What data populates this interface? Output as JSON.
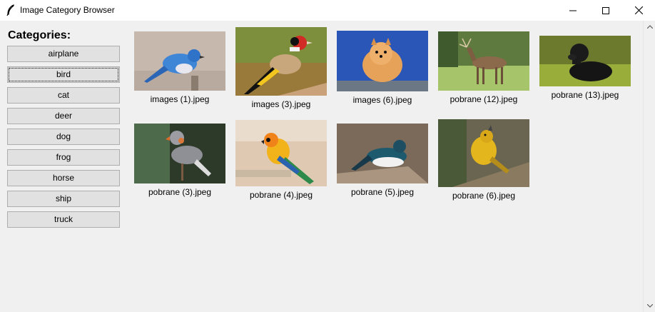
{
  "window": {
    "title": "Image Category Browser",
    "controls": {
      "minimize": "—",
      "maximize": "☐",
      "close": "✕"
    }
  },
  "sidebar": {
    "heading": "Categories:",
    "items": [
      {
        "label": "airplane"
      },
      {
        "label": "bird",
        "selected": true
      },
      {
        "label": "cat"
      },
      {
        "label": "deer"
      },
      {
        "label": "dog"
      },
      {
        "label": "frog"
      },
      {
        "label": "horse"
      },
      {
        "label": "ship"
      },
      {
        "label": "truck"
      }
    ]
  },
  "gallery": {
    "images": [
      {
        "filename": "images (1).jpeg",
        "subject": "blue bird on branch"
      },
      {
        "filename": "images (3).jpeg",
        "subject": "goldfinch on branch"
      },
      {
        "filename": "images (6).jpeg",
        "subject": "pomeranian dog"
      },
      {
        "filename": "pobrane (12).jpeg",
        "subject": "deer in field"
      },
      {
        "filename": "pobrane (13).jpeg",
        "subject": "black labrador in grass"
      },
      {
        "filename": "pobrane (3).jpeg",
        "subject": "zebra finch"
      },
      {
        "filename": "pobrane (4).jpeg",
        "subject": "sun conure parrot"
      },
      {
        "filename": "pobrane (5).jpeg",
        "subject": "tree swallow"
      },
      {
        "filename": "pobrane (6).jpeg",
        "subject": "yellow warbler singing"
      }
    ]
  },
  "icons": {
    "app": "feather-icon",
    "scroll_up": "chevron-up-icon",
    "scroll_down": "chevron-down-icon"
  }
}
